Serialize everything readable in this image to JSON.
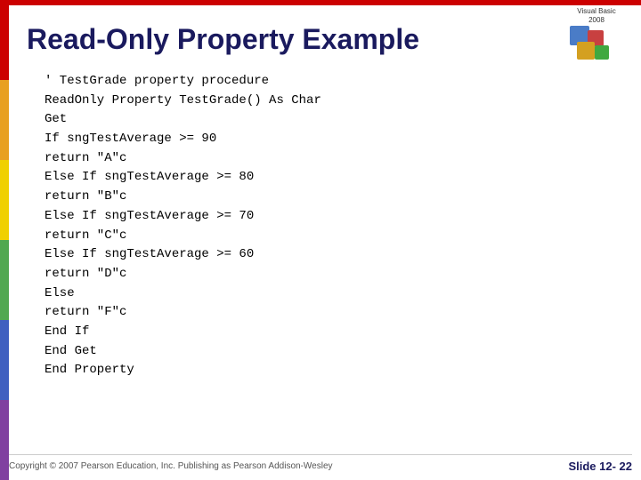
{
  "slide": {
    "title": "Read-Only Property Example",
    "code_lines": [
      "' TestGrade property procedure",
      "ReadOnly Property TestGrade() As Char",
      "    Get",
      "        If sngTestAverage >= 90",
      "            return \"A\"c",
      "        Else If sngTestAverage >= 80",
      "            return \"B\"c",
      "        Else If sngTestAverage >= 70",
      "            return \"C\"c",
      "        Else If sngTestAverage >= 60",
      "            return \"D\"c",
      "        Else",
      "            return \"F\"c",
      "        End If",
      "    End Get",
      "End Property"
    ]
  },
  "footer": {
    "copyright": "Copyright © 2007 Pearson Education, Inc. Publishing as Pearson Addison-Wesley",
    "slide_number": "Slide 12- 22"
  },
  "logo": {
    "line1": "Visual Basic",
    "line2": "2008"
  }
}
